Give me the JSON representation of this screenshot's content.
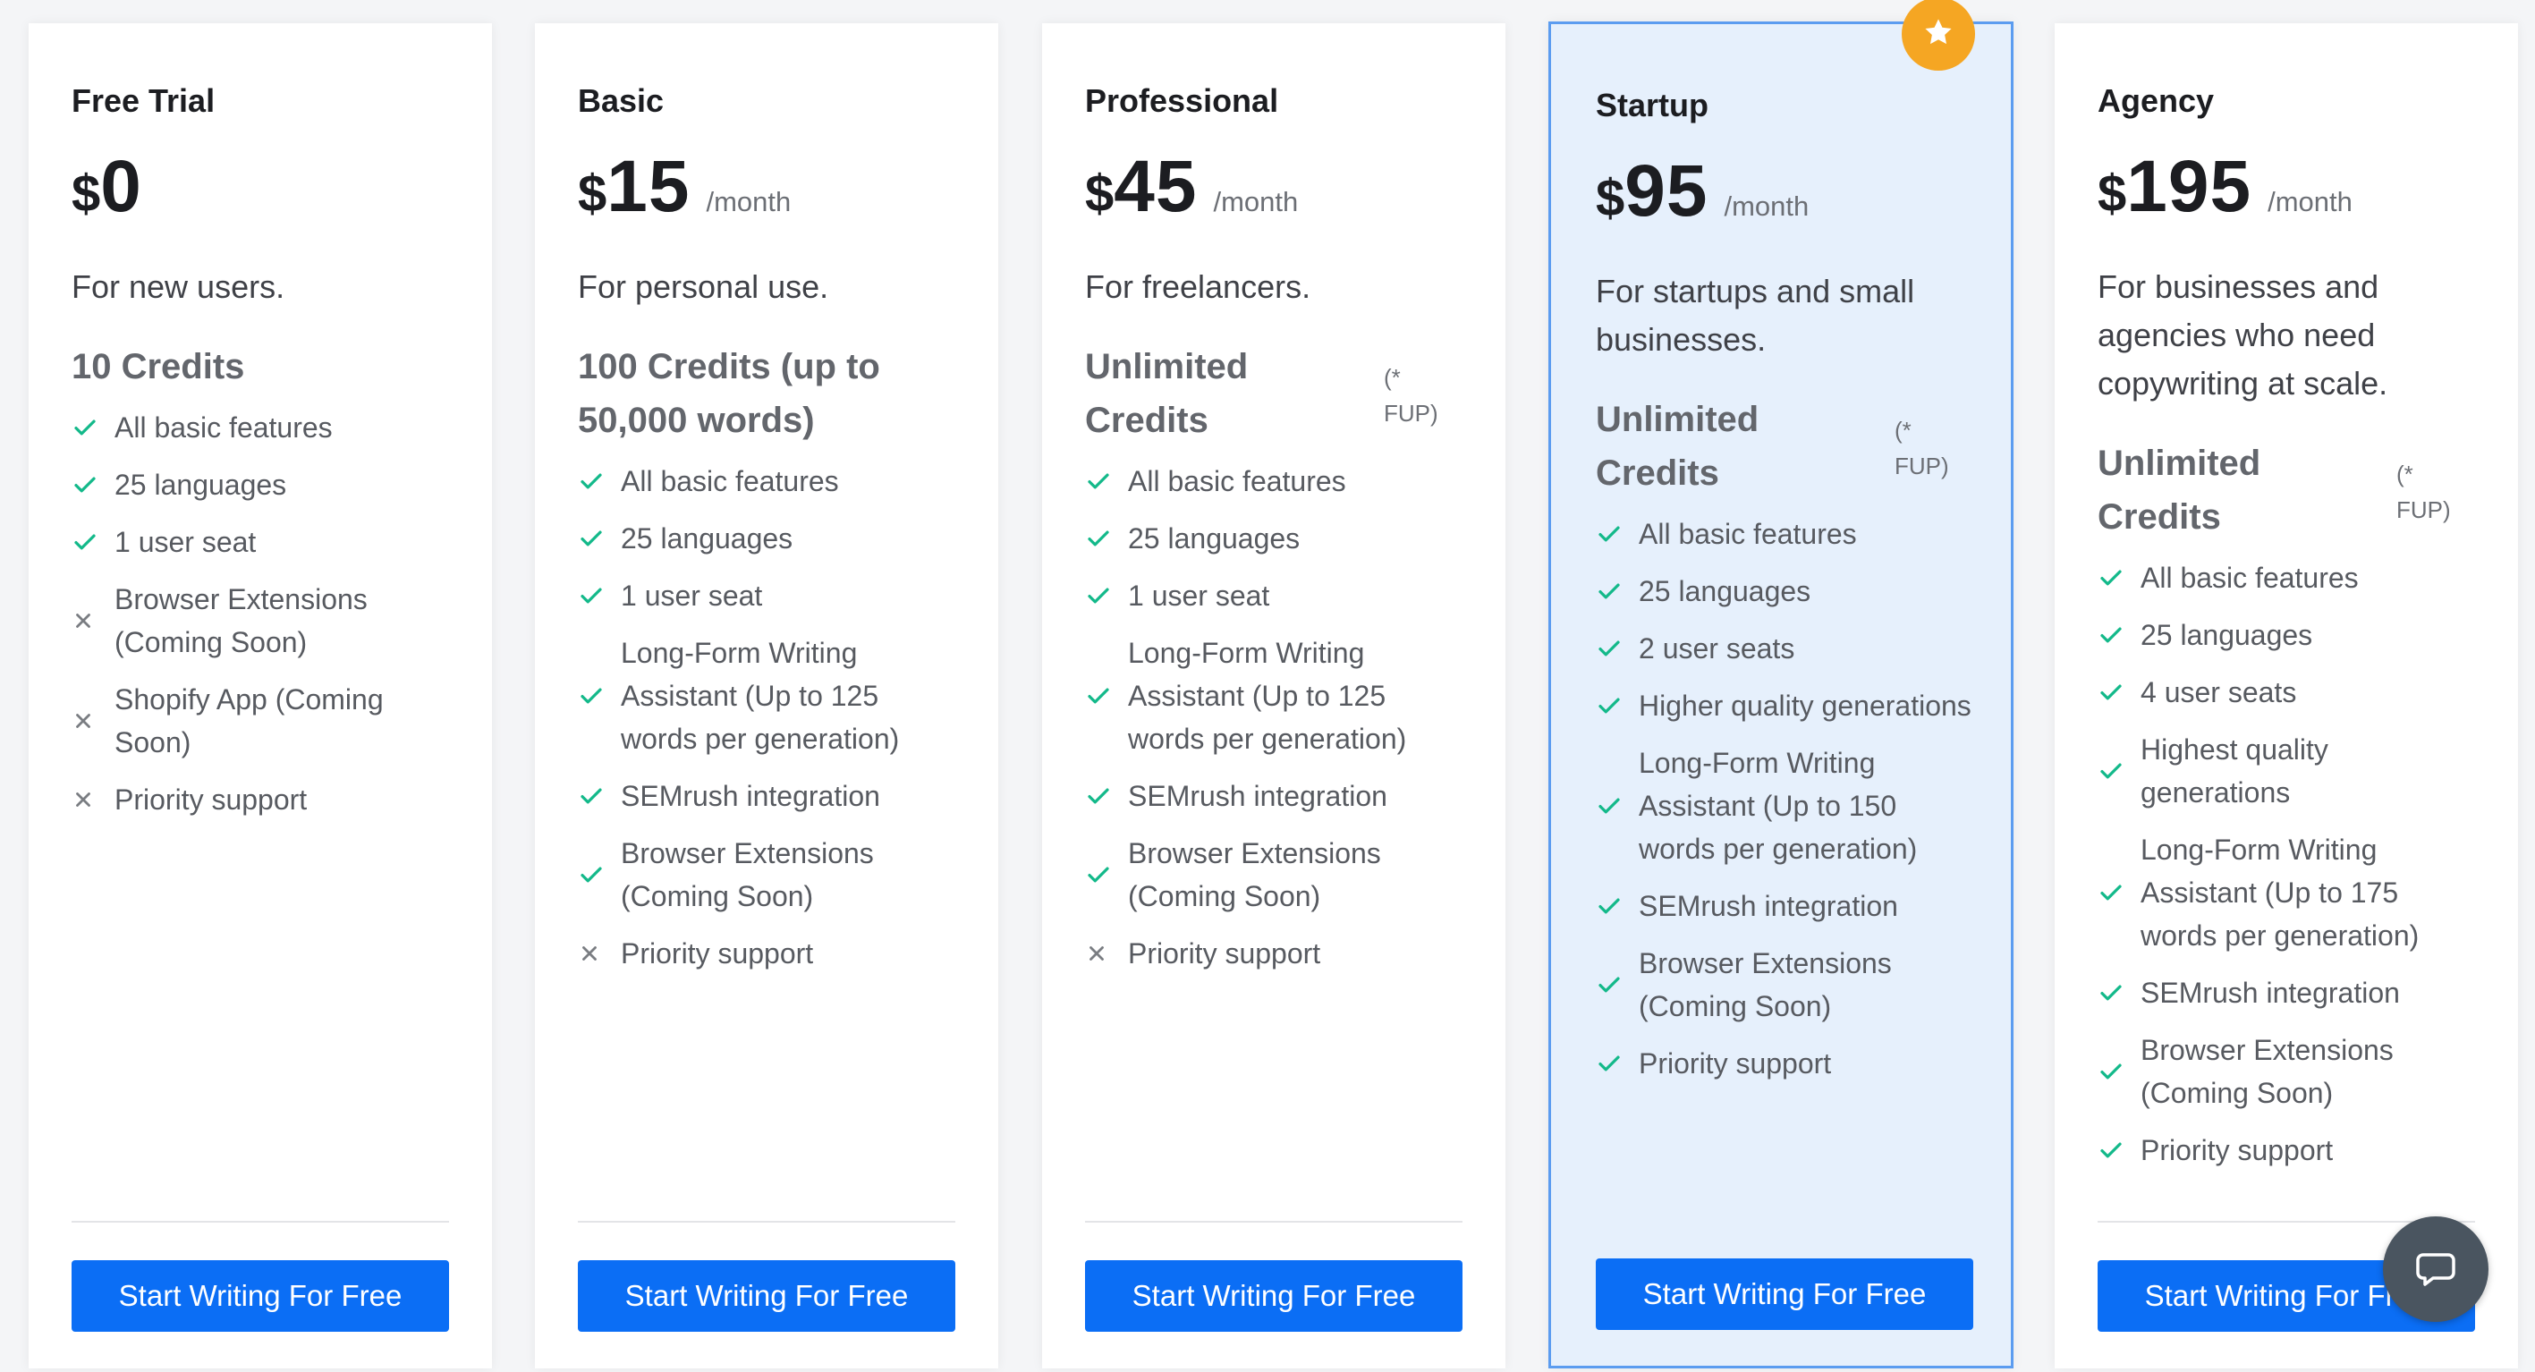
{
  "colors": {
    "page_background": "#f4f5f7",
    "card_background": "#ffffff",
    "featured_card_background": "#e6f0fc",
    "featured_border": "#5b9cf0",
    "cta_button": "#0b6ef5",
    "check_icon": "#13b98a",
    "cross_icon": "#7a7d82",
    "star_badge": "#f5a623",
    "chat_launcher": "#4a5560"
  },
  "plans": [
    {
      "name": "Free Trial",
      "currency": "$",
      "amount": "0",
      "period": "",
      "description": "For new users.",
      "credits": "10 Credits",
      "credits_note": "",
      "featured": false,
      "features": [
        {
          "text": "All basic features",
          "icon": "check-icon"
        },
        {
          "text": "25 languages",
          "icon": "check-icon"
        },
        {
          "text": "1 user seat",
          "icon": "check-icon"
        },
        {
          "text": "Browser Extensions (Coming Soon)",
          "icon": "cross-icon"
        },
        {
          "text": "Shopify App (Coming Soon)",
          "icon": "cross-icon"
        },
        {
          "text": "Priority support",
          "icon": "cross-icon"
        }
      ],
      "cta": "Start Writing For Free"
    },
    {
      "name": "Basic",
      "currency": "$",
      "amount": "15",
      "period": "/month",
      "description": "For personal use.",
      "credits": "100 Credits (up to 50,000 words)",
      "credits_note": "",
      "featured": false,
      "features": [
        {
          "text": "All basic features",
          "icon": "check-icon"
        },
        {
          "text": "25 languages",
          "icon": "check-icon"
        },
        {
          "text": "1 user seat",
          "icon": "check-icon"
        },
        {
          "text": "Long-Form Writing Assistant (Up to 125 words per generation)",
          "icon": "check-icon"
        },
        {
          "text": "SEMrush integration",
          "icon": "check-icon"
        },
        {
          "text": "Browser Extensions (Coming Soon)",
          "icon": "check-icon"
        },
        {
          "text": "Priority support",
          "icon": "cross-icon"
        }
      ],
      "cta": "Start Writing For Free"
    },
    {
      "name": "Professional",
      "currency": "$",
      "amount": "45",
      "period": "/month",
      "description": "For freelancers.",
      "credits": "Unlimited Credits",
      "credits_note": "(* FUP)",
      "featured": false,
      "features": [
        {
          "text": "All basic features",
          "icon": "check-icon"
        },
        {
          "text": "25 languages",
          "icon": "check-icon"
        },
        {
          "text": "1 user seat",
          "icon": "check-icon"
        },
        {
          "text": "Long-Form Writing Assistant (Up to 125 words per generation)",
          "icon": "check-icon"
        },
        {
          "text": "SEMrush integration",
          "icon": "check-icon"
        },
        {
          "text": "Browser Extensions (Coming Soon)",
          "icon": "check-icon"
        },
        {
          "text": "Priority support",
          "icon": "cross-icon"
        }
      ],
      "cta": "Start Writing For Free"
    },
    {
      "name": "Startup",
      "currency": "$",
      "amount": "95",
      "period": "/month",
      "description": "For startups and small businesses.",
      "credits": "Unlimited Credits",
      "credits_note": "(* FUP)",
      "featured": true,
      "badge_icon": "star-icon",
      "features": [
        {
          "text": "All basic features",
          "icon": "check-icon"
        },
        {
          "text": "25 languages",
          "icon": "check-icon"
        },
        {
          "text": "2 user seats",
          "icon": "check-icon"
        },
        {
          "text": "Higher quality generations",
          "icon": "check-icon"
        },
        {
          "text": "Long-Form Writing Assistant (Up to 150 words per generation)",
          "icon": "check-icon"
        },
        {
          "text": "SEMrush integration",
          "icon": "check-icon"
        },
        {
          "text": "Browser Extensions (Coming Soon)",
          "icon": "check-icon"
        },
        {
          "text": "Priority support",
          "icon": "check-icon"
        }
      ],
      "cta": "Start Writing For Free"
    },
    {
      "name": "Agency",
      "currency": "$",
      "amount": "195",
      "period": "/month",
      "description": "For businesses and agencies who need copywriting at scale.",
      "credits": "Unlimited Credits",
      "credits_note": "(* FUP)",
      "featured": false,
      "features": [
        {
          "text": "All basic features",
          "icon": "check-icon"
        },
        {
          "text": "25 languages",
          "icon": "check-icon"
        },
        {
          "text": "4 user seats",
          "icon": "check-icon"
        },
        {
          "text": "Highest quality generations",
          "icon": "check-icon"
        },
        {
          "text": "Long-Form Writing Assistant (Up to 175 words per generation)",
          "icon": "check-icon"
        },
        {
          "text": "SEMrush integration",
          "icon": "check-icon"
        },
        {
          "text": "Browser Extensions (Coming Soon)",
          "icon": "check-icon"
        },
        {
          "text": "Priority support",
          "icon": "check-icon"
        }
      ],
      "cta": "Start Writing For Free"
    }
  ],
  "chat_launcher": {
    "icon": "chat-icon"
  }
}
